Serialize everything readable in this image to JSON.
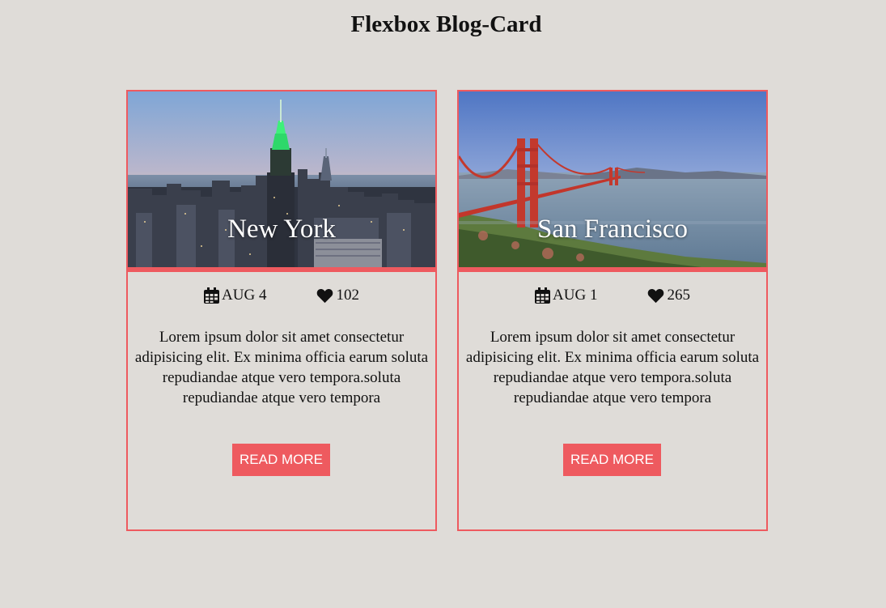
{
  "page": {
    "title": "Flexbox Blog-Card"
  },
  "colors": {
    "accent": "#ee5a5f",
    "background": "#dfdcd8"
  },
  "cards": [
    {
      "city": "New York",
      "date": "AUG 4",
      "likes": "102",
      "excerpt": "Lorem ipsum dolor sit amet consectetur adipisicing elit. Ex minima officia earum soluta repudiandae atque vero tempora.soluta repudiandae atque vero tempora",
      "button_label": "READ MORE",
      "date_icon": "calendar-icon",
      "likes_icon": "heart-icon"
    },
    {
      "city": "San Francisco",
      "date": "AUG 1",
      "likes": "265",
      "excerpt": "Lorem ipsum dolor sit amet consectetur adipisicing elit. Ex minima officia earum soluta repudiandae atque vero tempora.soluta repudiandae atque vero tempora",
      "button_label": "READ MORE",
      "date_icon": "calendar-icon",
      "likes_icon": "heart-icon"
    }
  ]
}
